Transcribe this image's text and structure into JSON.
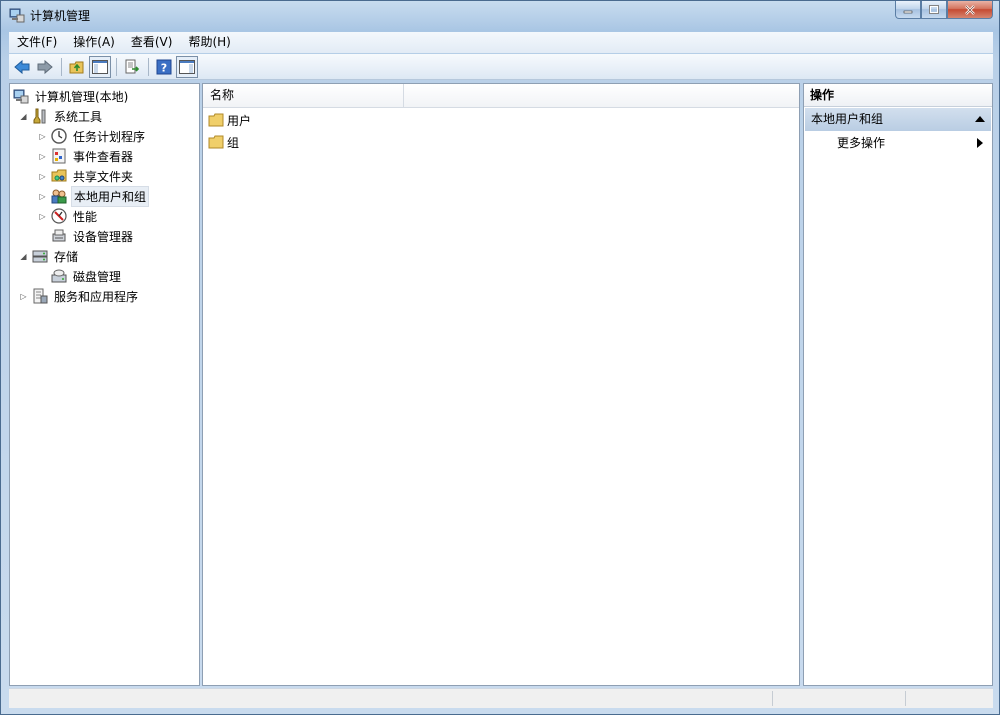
{
  "window": {
    "title": "计算机管理",
    "buttons": [
      "minimize",
      "maximize",
      "close"
    ]
  },
  "menubar": {
    "items": [
      "文件(F)",
      "操作(A)",
      "查看(V)",
      "帮助(H)"
    ]
  },
  "toolbar": {
    "icons": [
      "back-arrow-icon",
      "forward-arrow-icon",
      "up-folder-icon",
      "show-hide-tree-icon",
      "export-list-icon",
      "help-icon",
      "show-hide-action-pane-icon"
    ]
  },
  "tree": {
    "items": [
      {
        "label": "计算机管理(本地)",
        "level": 0,
        "expander": "none",
        "icon": "computer-management-icon"
      },
      {
        "label": "系统工具",
        "level": 1,
        "expander": "expanded",
        "icon": "system-tools-icon"
      },
      {
        "label": "任务计划程序",
        "level": 2,
        "expander": "collapsed",
        "icon": "clock-icon"
      },
      {
        "label": "事件查看器",
        "level": 2,
        "expander": "collapsed",
        "icon": "event-viewer-icon"
      },
      {
        "label": "共享文件夹",
        "level": 2,
        "expander": "collapsed",
        "icon": "shared-folder-icon"
      },
      {
        "label": "本地用户和组",
        "level": 2,
        "expander": "collapsed",
        "icon": "users-icon",
        "selected": true
      },
      {
        "label": "性能",
        "level": 2,
        "expander": "collapsed",
        "icon": "performance-icon"
      },
      {
        "label": "设备管理器",
        "level": 2,
        "expander": "none",
        "icon": "device-manager-icon"
      },
      {
        "label": "存储",
        "level": 1,
        "expander": "expanded",
        "icon": "storage-icon"
      },
      {
        "label": "磁盘管理",
        "level": 2,
        "expander": "none",
        "icon": "disk-management-icon"
      },
      {
        "label": "服务和应用程序",
        "level": 1,
        "expander": "collapsed",
        "icon": "services-icon"
      }
    ]
  },
  "list": {
    "column_name": "名称",
    "rows": [
      {
        "label": "用户",
        "icon": "folder-icon"
      },
      {
        "label": "组",
        "icon": "folder-icon"
      }
    ]
  },
  "actions": {
    "title": "操作",
    "group_label": "本地用户和组",
    "more_label": "更多操作"
  },
  "colors": {
    "frame": "#b9d0e8",
    "selection": "#e8eef5",
    "action_group": "#c5d6ea"
  }
}
